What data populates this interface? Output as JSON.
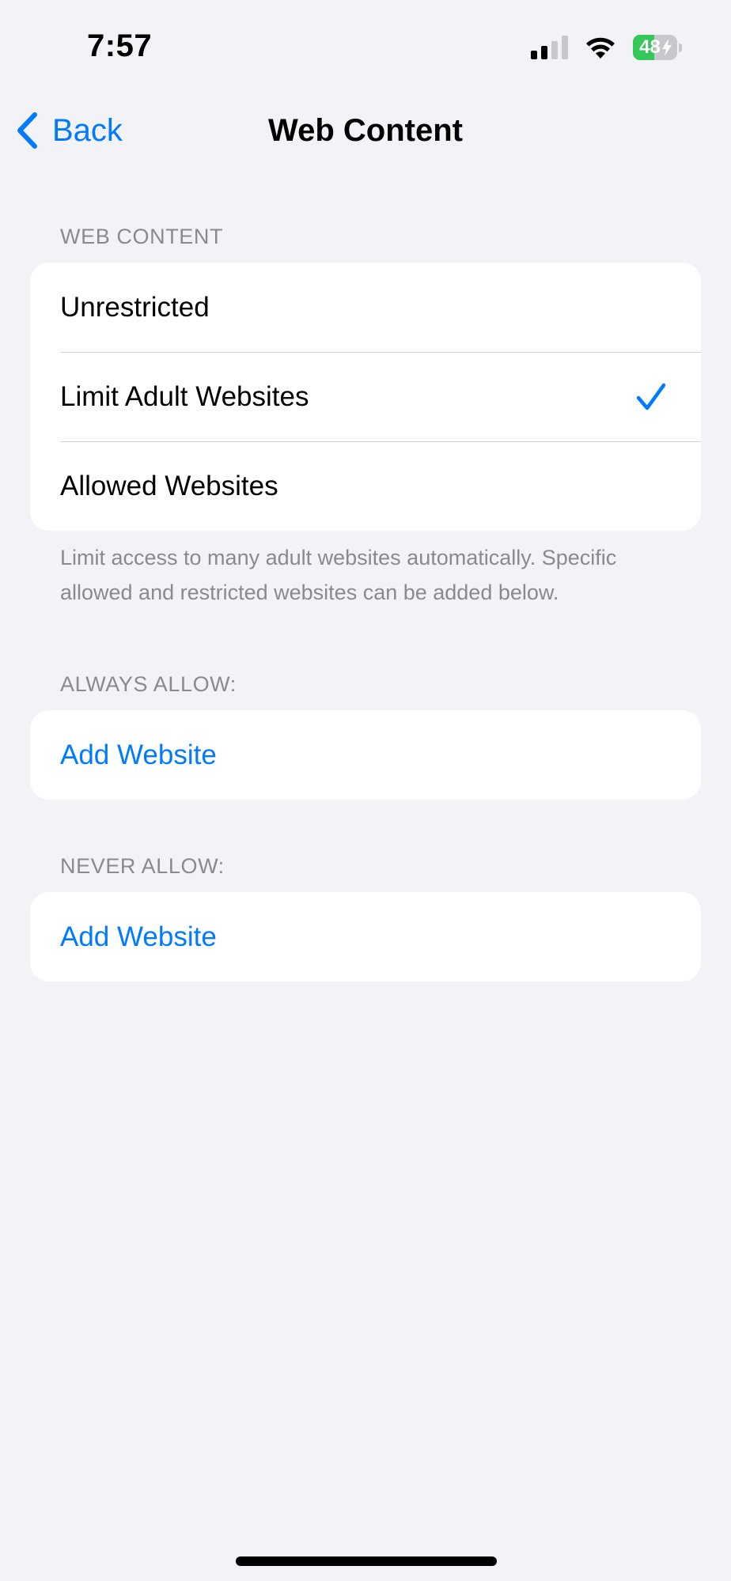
{
  "status_bar": {
    "time": "7:57",
    "signal_icon": "cellular-signal-icon",
    "wifi_icon": "wifi-icon",
    "battery_level": "48",
    "battery_percent": 48,
    "battery_icon": "battery-charging-icon"
  },
  "nav": {
    "back_label": "Back",
    "back_icon": "chevron-left-icon",
    "title": "Web Content"
  },
  "web_content": {
    "header": "WEB CONTENT",
    "options": [
      {
        "label": "Unrestricted",
        "selected": false
      },
      {
        "label": "Limit Adult Websites",
        "selected": true
      },
      {
        "label": "Allowed Websites",
        "selected": false
      }
    ],
    "footer": "Limit access to many adult websites automatically. Specific allowed and restricted websites can be added below."
  },
  "always_allow": {
    "header": "ALWAYS ALLOW:",
    "add_label": "Add Website"
  },
  "never_allow": {
    "header": "NEVER ALLOW:",
    "add_label": "Add Website"
  },
  "colors": {
    "accent": "#007aff",
    "background": "#f2f2f7",
    "secondary_text": "#8a8a8e",
    "battery_green": "#34c759"
  }
}
